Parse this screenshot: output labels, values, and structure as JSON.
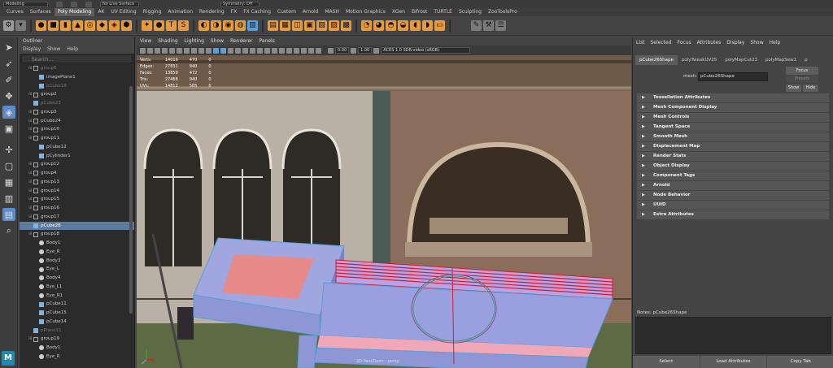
{
  "topbar": {
    "menu_set": "Modeling",
    "live_surface": "No Live Surface",
    "symmetry": "Symmetry: Off"
  },
  "shelf_tabs": [
    "Curves",
    "Surfaces",
    "Poly Modeling",
    "AK",
    "UV Editing",
    "Rigging",
    "Animation",
    "Rendering",
    "FX",
    "FX Caching",
    "Custom",
    "Arnold",
    "MASH",
    "Motion Graphics",
    "XGen",
    "Bifrost",
    "TURTLE",
    "Sculpting",
    "ZooToolsPro"
  ],
  "outliner": {
    "title": "Outliner",
    "menu": [
      "Display",
      "Show",
      "Help"
    ],
    "search_placeholder": "Search...",
    "rows": [
      {
        "label": "group6",
        "type": "group",
        "indent": 1,
        "dim": true
      },
      {
        "label": "imagePlane1",
        "type": "mesh",
        "indent": 2,
        "dim": false
      },
      {
        "label": "pCube18",
        "type": "mesh",
        "indent": 2,
        "dim": true
      },
      {
        "label": "group2",
        "type": "group",
        "indent": 1,
        "dim": false
      },
      {
        "label": "pCube23",
        "type": "mesh",
        "indent": 1,
        "dim": true
      },
      {
        "label": "group3",
        "type": "group",
        "indent": 1,
        "dim": false
      },
      {
        "label": "pCube24",
        "type": "group",
        "indent": 1,
        "dim": false
      },
      {
        "label": "group10",
        "type": "group",
        "indent": 1,
        "dim": false
      },
      {
        "label": "group11",
        "type": "group",
        "indent": 1,
        "dim": false
      },
      {
        "label": "pCube12",
        "type": "mesh",
        "indent": 2,
        "dim": false
      },
      {
        "label": "pCylinder1",
        "type": "mesh",
        "indent": 2,
        "dim": false
      },
      {
        "label": "group12",
        "type": "group",
        "indent": 1,
        "dim": false
      },
      {
        "label": "group4",
        "type": "group",
        "indent": 1,
        "dim": false
      },
      {
        "label": "group13",
        "type": "group",
        "indent": 1,
        "dim": false
      },
      {
        "label": "group14",
        "type": "group",
        "indent": 1,
        "dim": false
      },
      {
        "label": "group15",
        "type": "group",
        "indent": 1,
        "dim": false
      },
      {
        "label": "group16",
        "type": "group",
        "indent": 1,
        "dim": false
      },
      {
        "label": "group17",
        "type": "group",
        "indent": 1,
        "dim": false
      },
      {
        "label": "pCube26",
        "type": "mesh",
        "indent": 1,
        "dim": false,
        "selected": true
      },
      {
        "label": "group18",
        "type": "group",
        "indent": 1,
        "dim": false
      },
      {
        "label": "Body1",
        "type": "joint",
        "indent": 2,
        "dim": false
      },
      {
        "label": "Eye_R",
        "type": "joint",
        "indent": 2,
        "dim": false
      },
      {
        "label": "Body3",
        "type": "joint",
        "indent": 2,
        "dim": false
      },
      {
        "label": "Eye_L",
        "type": "joint",
        "indent": 2,
        "dim": false
      },
      {
        "label": "Body4",
        "type": "joint",
        "indent": 2,
        "dim": false
      },
      {
        "label": "Eye_L1",
        "type": "joint",
        "indent": 2,
        "dim": false
      },
      {
        "label": "Eye_R1",
        "type": "joint",
        "indent": 2,
        "dim": false
      },
      {
        "label": "pCube11",
        "type": "mesh",
        "indent": 2,
        "dim": false
      },
      {
        "label": "pCube15",
        "type": "mesh",
        "indent": 2,
        "dim": false
      },
      {
        "label": "pCube14",
        "type": "mesh",
        "indent": 2,
        "dim": false
      },
      {
        "label": "pPlane11",
        "type": "mesh",
        "indent": 1,
        "dim": true
      },
      {
        "label": "group19",
        "type": "group",
        "indent": 1,
        "dim": false
      },
      {
        "label": "Body1",
        "type": "joint",
        "indent": 2,
        "dim": false
      },
      {
        "label": "Eye_R",
        "type": "joint",
        "indent": 2,
        "dim": false
      }
    ]
  },
  "viewport": {
    "menu": [
      "View",
      "Shading",
      "Lighting",
      "Show",
      "Renderer",
      "Panels"
    ],
    "gamma": "0.00",
    "exposure": "1.00",
    "color_space": "ACES 1.0 SDR-video (sRGB)",
    "camera_label": "2D Pan/Zoom : persp",
    "hud": {
      "col1": [
        "Verts:",
        "Edges:",
        "Faces:",
        "Tris:",
        "UVs:"
      ],
      "col2": [
        "14016",
        "27831",
        "13859",
        "27468",
        "14812"
      ],
      "col3": [
        "470",
        "940",
        "472",
        "940",
        "565"
      ],
      "col4": [
        "0",
        "0",
        "0",
        "0",
        "0"
      ]
    }
  },
  "attribute_editor": {
    "menu": [
      "List",
      "Selected",
      "Focus",
      "Attributes",
      "Display",
      "Show",
      "Help"
    ],
    "tabs": [
      "pCube26Shape",
      "polyTweakUV25",
      "polyMapCut23",
      "polyMapSew1",
      "p"
    ],
    "mesh_label": "mesh:",
    "mesh_value": "pCube26Shape",
    "focus_label": "Focus",
    "presets_label": "Presets",
    "show_label": "Show",
    "hide_label": "Hide",
    "sections": [
      "Tessellation Attributes",
      "Mesh Component Display",
      "Mesh Controls",
      "Tangent Space",
      "Smooth Mesh",
      "Displacement Map",
      "Render Stats",
      "Object Display",
      "Component Tags",
      "Arnold",
      "Node Behavior",
      "UUID",
      "Extra Attributes"
    ],
    "notes_label": "Notes: pCube26Shape",
    "buttons": [
      "Select",
      "Load Attributes",
      "Copy Tab"
    ]
  },
  "colors": {
    "selection": "#5d7da0",
    "accent": "#e79a3d",
    "selected_tool": "#5b8cc7",
    "model_face": "#9aa3dc",
    "highlight_face": "#e88a8a",
    "edge_red": "#d81a2a"
  }
}
